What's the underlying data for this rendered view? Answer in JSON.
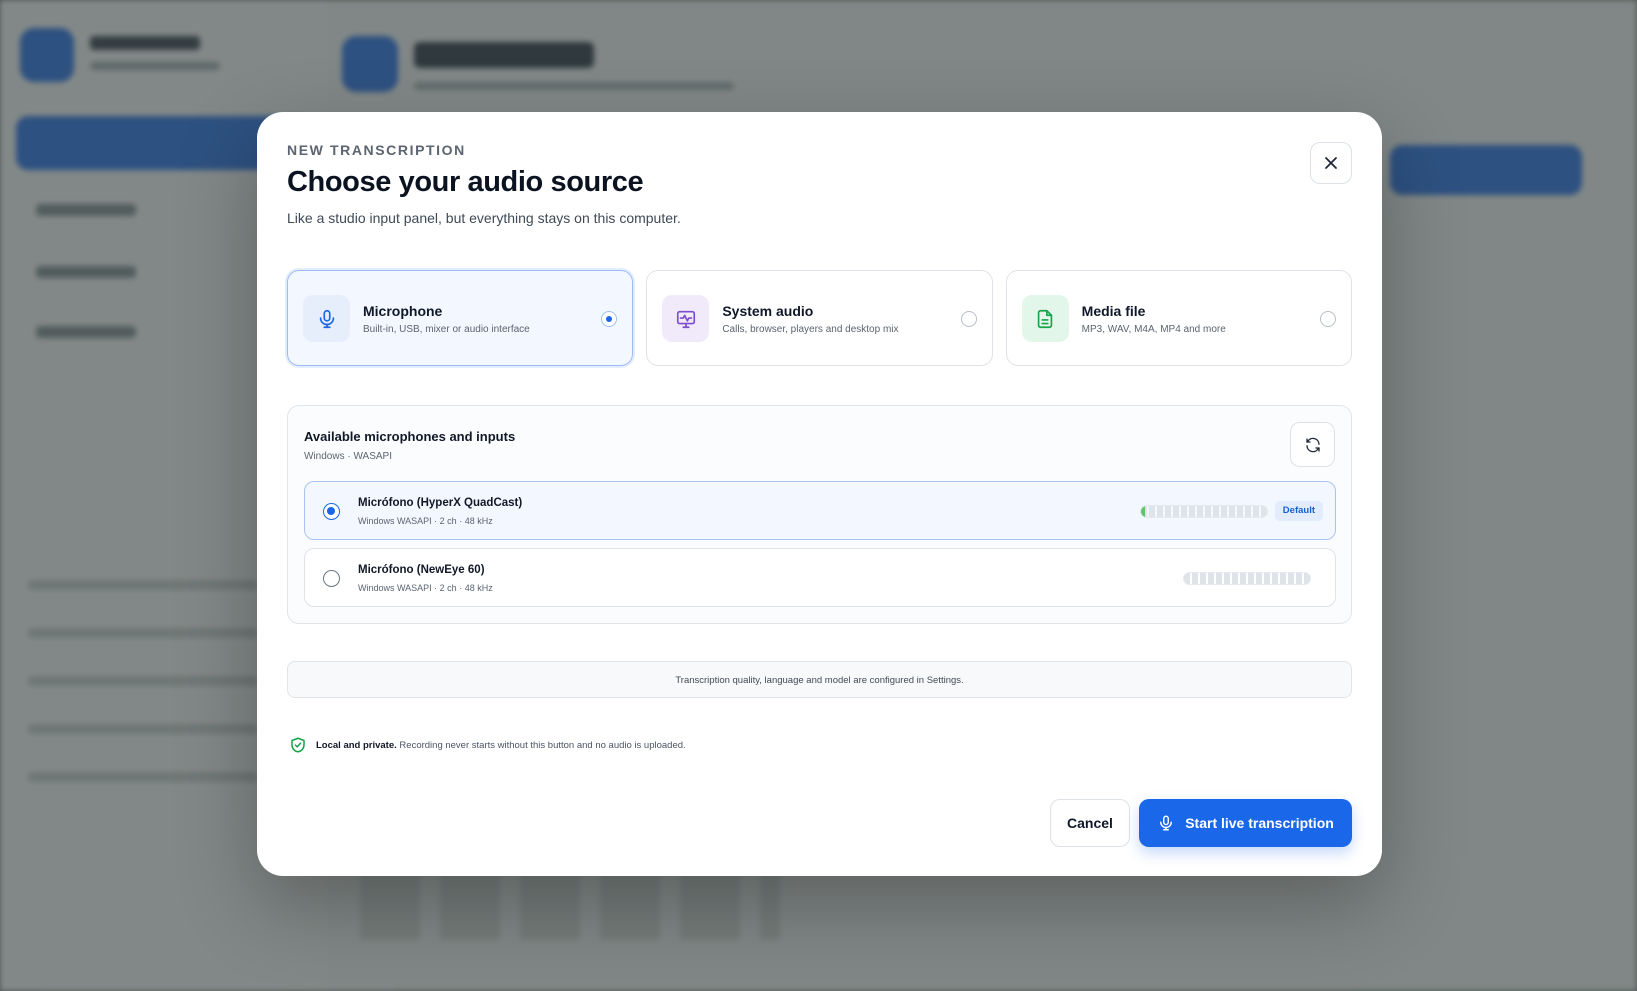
{
  "dialog": {
    "eyebrow": "NEW TRANSCRIPTION",
    "title": "Choose your audio source",
    "subtitle": "Like a studio input panel, but everything stays on this computer."
  },
  "sources": [
    {
      "name": "Microphone",
      "description": "Built-in, USB, mixer or audio interface",
      "icon": "microphone-icon",
      "selected": true
    },
    {
      "name": "System audio",
      "description": "Calls, browser, players and desktop mix",
      "icon": "monitor-icon",
      "selected": false
    },
    {
      "name": "Media file",
      "description": "MP3, WAV, M4A, MP4 and more",
      "icon": "file-icon",
      "selected": false
    }
  ],
  "inputs": {
    "title": "Available microphones and inputs",
    "subtitle": "Windows · WASAPI",
    "devices": [
      {
        "name": "Micrófono (HyperX QuadCast)",
        "meta": "Windows WASAPI · 2 ch · 48 kHz",
        "selected": true,
        "badge": "Default",
        "level": 0.03
      },
      {
        "name": "Micrófono (NewEye 60)",
        "meta": "Windows WASAPI · 2 ch · 48 kHz",
        "selected": false,
        "level": 0
      }
    ]
  },
  "settings_note": "Transcription quality, language and model are configured in Settings.",
  "privacy": {
    "bold": "Local and private.",
    "text": "Recording never starts without this button and no audio is uploaded."
  },
  "actions": {
    "cancel": "Cancel",
    "start": "Start live transcription"
  },
  "colors": {
    "accent": "#1b67ea",
    "microphone_icon": "#1a66e6",
    "system_icon": "#7c4dcc",
    "file_icon": "#16a34a",
    "level_meter": "#5fc46a",
    "privacy_icon": "#16a34a"
  }
}
